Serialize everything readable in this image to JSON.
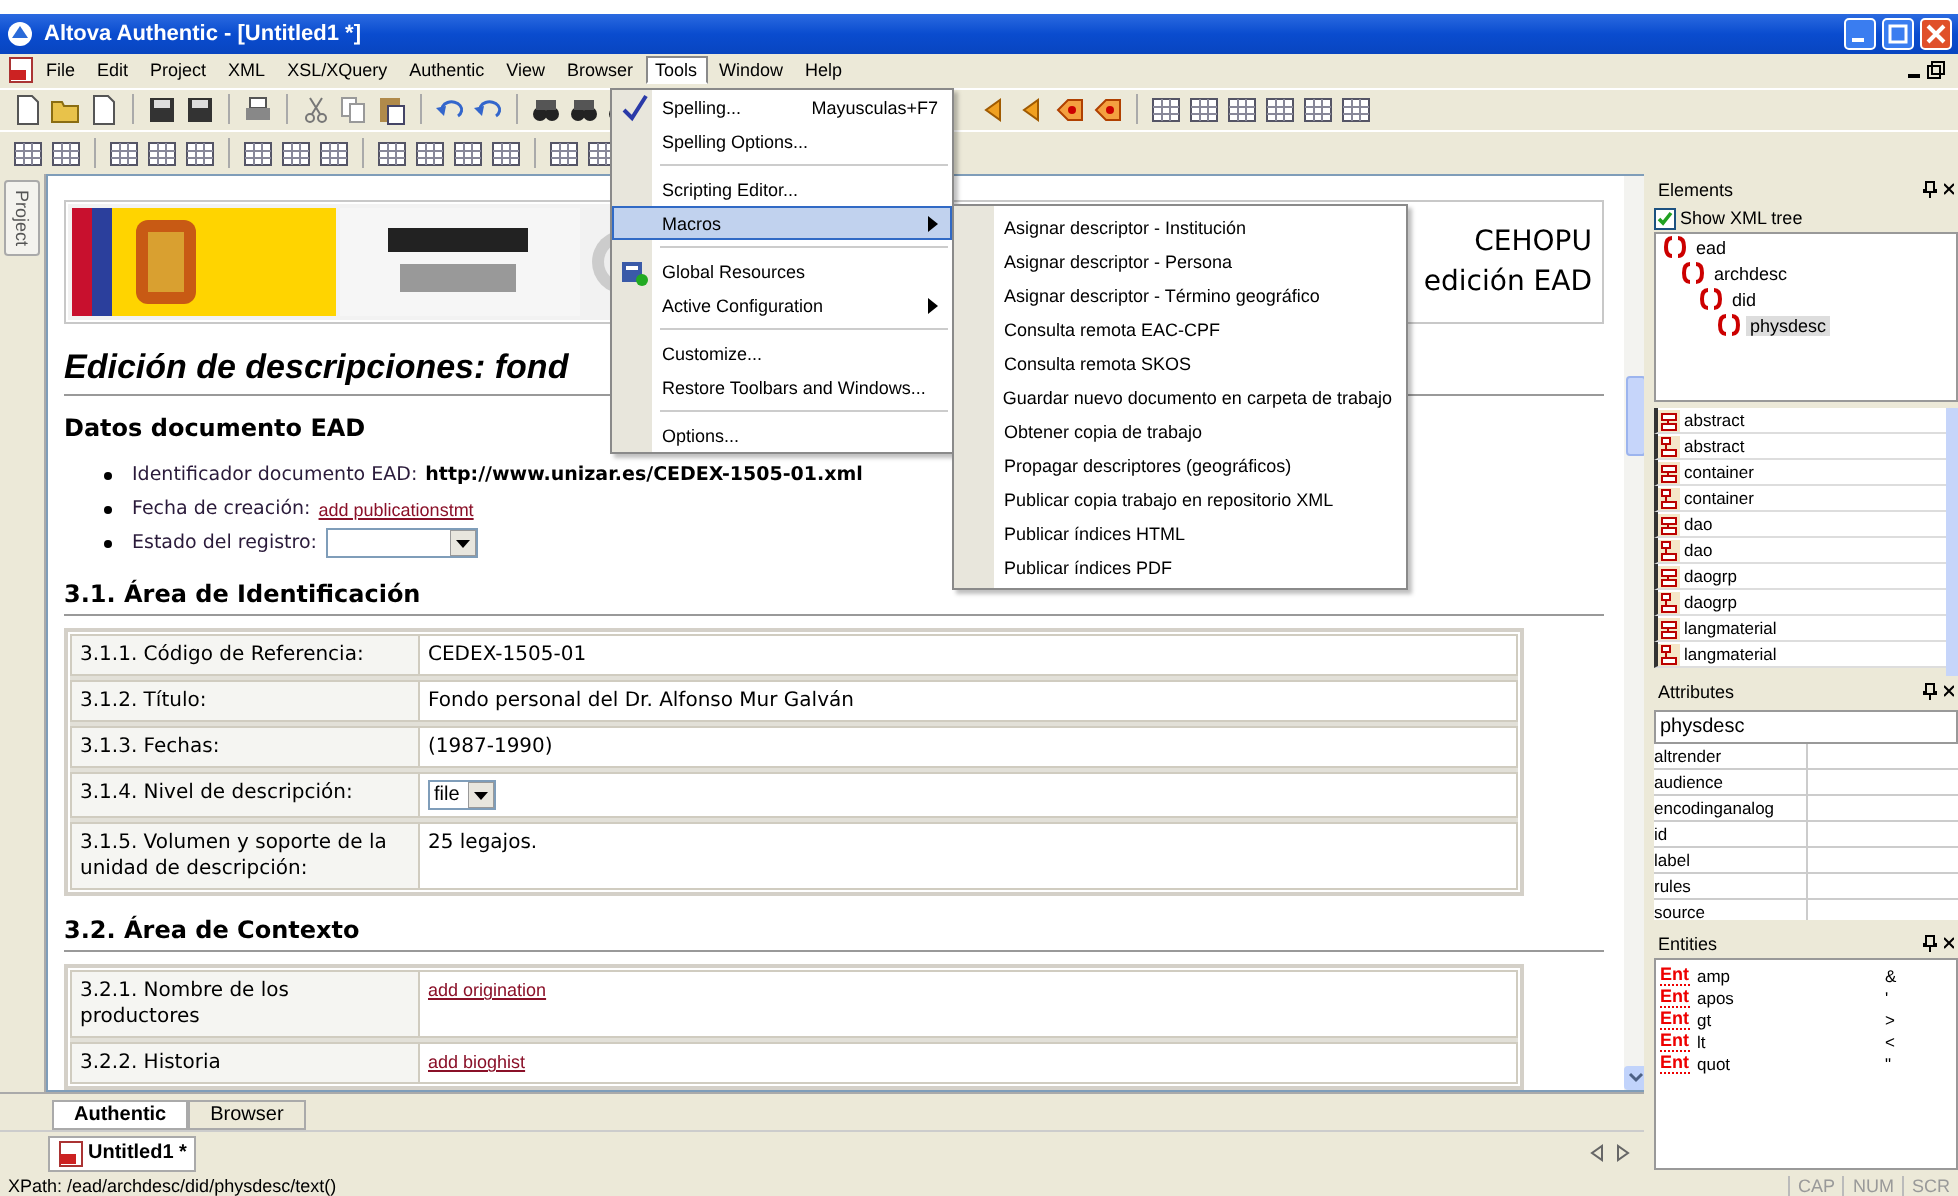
{
  "window": {
    "title": "Altova Authentic - [Untitled1 *]"
  },
  "menu_bar": [
    {
      "label": "File",
      "selected": false
    },
    {
      "label": "Edit",
      "selected": false
    },
    {
      "label": "Project",
      "selected": false
    },
    {
      "label": "XML",
      "selected": false
    },
    {
      "label": "XSL/XQuery",
      "selected": false
    },
    {
      "label": "Authentic",
      "selected": false
    },
    {
      "label": "View",
      "selected": false
    },
    {
      "label": "Browser",
      "selected": false
    },
    {
      "label": "Tools",
      "selected": true
    },
    {
      "label": "Window",
      "selected": false
    },
    {
      "label": "Help",
      "selected": false
    }
  ],
  "tools_menu": [
    {
      "kind": "item",
      "label": "Spelling...",
      "shortcut": "Mayusculas+F7",
      "selected": false
    },
    {
      "kind": "item",
      "label": "Spelling Options...",
      "selected": false
    },
    {
      "kind": "separator"
    },
    {
      "kind": "item",
      "label": "Scripting Editor...",
      "selected": false
    },
    {
      "kind": "submenu",
      "label": "Macros",
      "selected": true
    },
    {
      "kind": "separator"
    },
    {
      "kind": "item",
      "label": "Global Resources",
      "selected": false
    },
    {
      "kind": "submenu",
      "label": "Active Configuration",
      "selected": false
    },
    {
      "kind": "separator"
    },
    {
      "kind": "item",
      "label": "Customize...",
      "selected": false
    },
    {
      "kind": "item",
      "label": "Restore Toolbars and Windows...",
      "selected": false
    },
    {
      "kind": "separator"
    },
    {
      "kind": "item",
      "label": "Options...",
      "selected": false
    }
  ],
  "macros_submenu": [
    "Asignar descriptor - Institución",
    "Asignar descriptor - Persona",
    "Asignar descriptor - Término geográfico",
    "Consulta remota EAC-CPF",
    "Consulta remota SKOS",
    "Guardar nuevo documento en carpeta de trabajo",
    "Obtener copia de trabajo",
    "Propagar descriptores (geográficos)",
    "Publicar copia trabajo en repositorio XML",
    "Publicar índices HTML",
    "Publicar índices PDF"
  ],
  "project_tab": {
    "label": "Project"
  },
  "document": {
    "header_texts": [
      "CEHOPU",
      "edición EAD"
    ],
    "title": "Edición de descripciones: fond",
    "sections": [
      {
        "heading": "Datos documento EAD",
        "bullets": [
          {
            "label": "Identificador documento EAD:",
            "kind": "text",
            "value": "http://www.unizar.es/CEDEX-1505-01.xml"
          },
          {
            "label": "Fecha de creación:",
            "kind": "link",
            "value": "add publicationstmt"
          },
          {
            "label": "Estado del registro:",
            "kind": "dropdown"
          }
        ]
      },
      {
        "heading": "3.1. Área de Identificación",
        "rows": [
          {
            "label": "3.1.1. Código de Referencia:",
            "kind": "text",
            "value": "CEDEX-1505-01"
          },
          {
            "label": "3.1.2. Título:",
            "kind": "text",
            "value": "Fondo personal del Dr. Alfonso Mur Galván"
          },
          {
            "label": "3.1.3. Fechas:",
            "kind": "text",
            "value": "(1987-1990)"
          },
          {
            "label": "3.1.4. Nivel de descripción:",
            "kind": "dropdown",
            "value": "file"
          },
          {
            "label": "3.1.5. Volumen y soporte de la unidad de descripción:",
            "kind": "text",
            "value": "25 legajos."
          }
        ]
      },
      {
        "heading": "3.2. Área de Contexto",
        "rows": [
          {
            "label": "3.2.1. Nombre de los productores",
            "kind": "link",
            "value": "add origination"
          },
          {
            "label": "3.2.2. Historia",
            "kind": "link",
            "value": "add bioghist"
          }
        ]
      }
    ]
  },
  "view_tabs": [
    {
      "label": "Authentic",
      "selected": true
    },
    {
      "label": "Browser",
      "selected": false
    }
  ],
  "document_tabs": [
    {
      "label": "Untitled1 *",
      "selected": true
    }
  ],
  "elements_panel": {
    "title": "Elements",
    "show_xml_tree": {
      "label": "Show XML tree",
      "checked": true
    },
    "tree": [
      {
        "label": "ead",
        "selected": false,
        "children": [
          {
            "label": "archdesc",
            "selected": false,
            "children": [
              {
                "label": "did",
                "selected": false,
                "children": [
                  {
                    "label": "physdesc",
                    "selected": true
                  }
                ]
              }
            ]
          }
        ]
      }
    ],
    "items": [
      {
        "label": "abstract",
        "kind": "insert"
      },
      {
        "label": "abstract",
        "kind": "append"
      },
      {
        "label": "container",
        "kind": "insert"
      },
      {
        "label": "container",
        "kind": "append"
      },
      {
        "label": "dao",
        "kind": "insert"
      },
      {
        "label": "dao",
        "kind": "append"
      },
      {
        "label": "daogrp",
        "kind": "insert"
      },
      {
        "label": "daogrp",
        "kind": "append"
      },
      {
        "label": "langmaterial",
        "kind": "insert"
      },
      {
        "label": "langmaterial",
        "kind": "append"
      }
    ]
  },
  "attributes_panel": {
    "title": "Attributes",
    "element": "physdesc",
    "rows": [
      "altrender",
      "audience",
      "encodinganalog",
      "id",
      "label",
      "rules",
      "source"
    ]
  },
  "entities_panel": {
    "title": "Entities",
    "rows": [
      {
        "tag": "Ent",
        "name": "amp",
        "value": "&"
      },
      {
        "tag": "Ent",
        "name": "apos",
        "value": "'"
      },
      {
        "tag": "Ent",
        "name": "gt",
        "value": ">"
      },
      {
        "tag": "Ent",
        "name": "lt",
        "value": "<"
      },
      {
        "tag": "Ent",
        "name": "quot",
        "value": "\""
      }
    ]
  },
  "status_bar": {
    "xpath": "XPath: /ead/archdesc/did/physdesc/text()",
    "indicators": [
      "CAP",
      "NUM",
      "SCR"
    ]
  }
}
